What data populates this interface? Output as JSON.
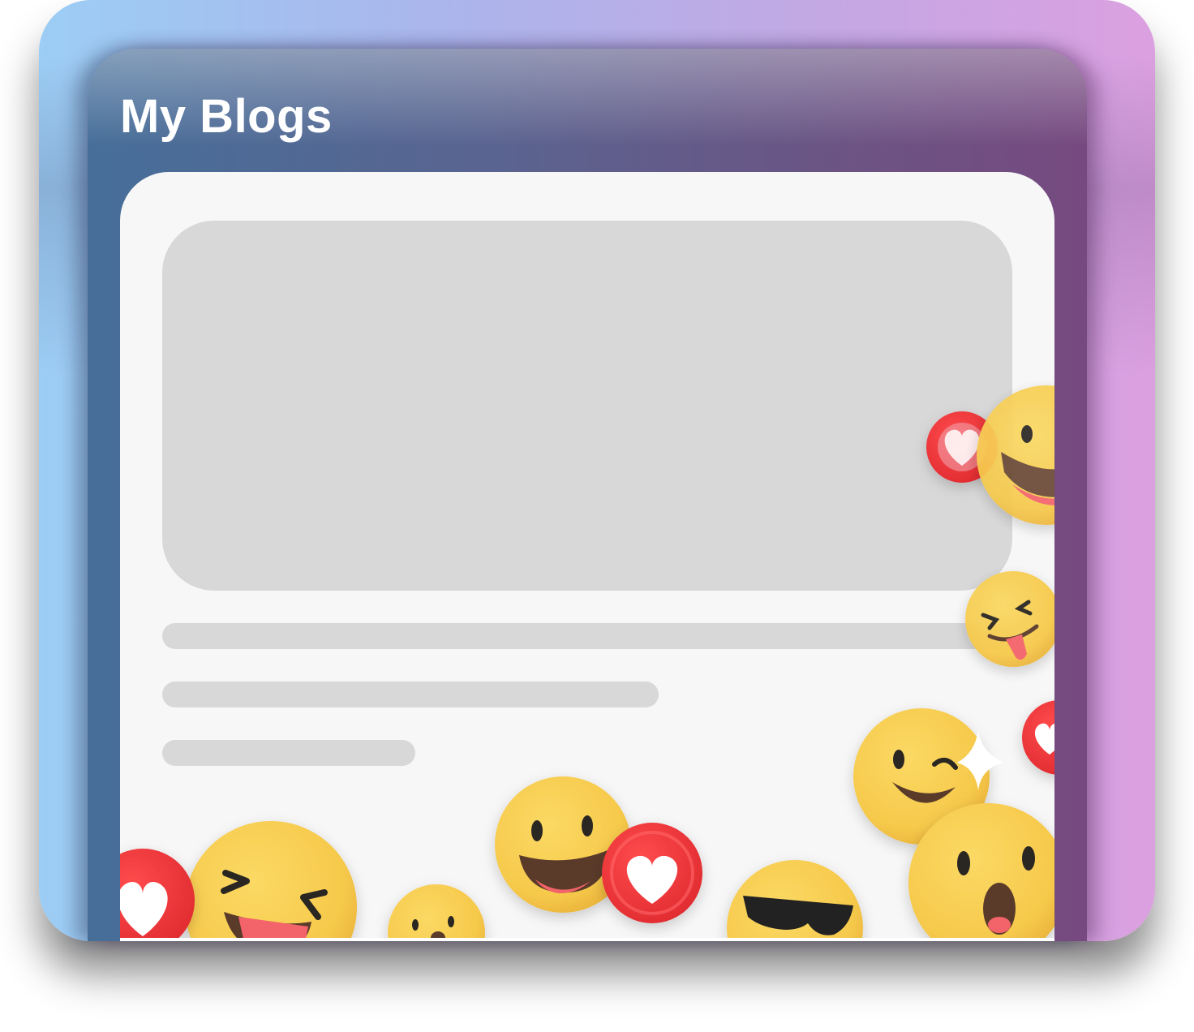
{
  "page": {
    "title": "My Blogs"
  },
  "colors": {
    "gradient_left": "#9ccdf4",
    "gradient_right": "#dba0e0",
    "panel_left": "#466e99",
    "panel_right": "#764a80",
    "card_bg": "#f7f7f7",
    "placeholder": "#d8d8d8",
    "emoji_yellow": "#f7cd4f",
    "heart_red": "#f23a3c"
  },
  "icons": [
    "heart-icon",
    "grin-emoji-icon",
    "tongue-wink-emoji-icon",
    "wink-emoji-icon",
    "sunglasses-emoji-icon",
    "surprised-emoji-icon",
    "squint-tongue-emoji-icon",
    "small-surprised-emoji-icon",
    "sparkle-icon"
  ]
}
